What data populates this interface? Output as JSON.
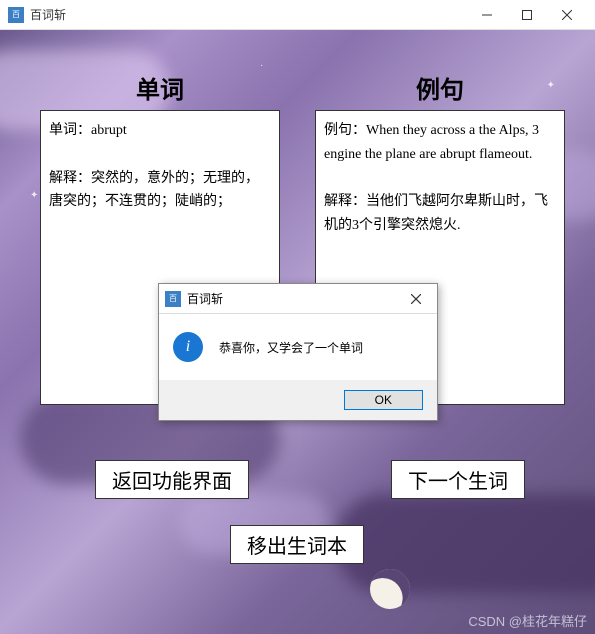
{
  "titlebar": {
    "title": "百词斩"
  },
  "headings": {
    "word": "单词",
    "example": "例句"
  },
  "word_panel": {
    "word_label": "单词：",
    "word_value": "abrupt",
    "def_label": "解释：",
    "def_value": "突然的，意外的；无理的，唐突的；不连贯的；陡峭的；"
  },
  "example_panel": {
    "sentence_label": "例句：",
    "sentence_value": "When they across a the Alps, 3 engine the plane are abrupt flameout.",
    "def_label": "解释：",
    "def_value": "当他们飞越阿尔卑斯山时，飞机的3个引擎突然熄火."
  },
  "buttons": {
    "back": "返回功能界面",
    "next": "下一个生词",
    "remove": "移出生词本"
  },
  "dialog": {
    "title": "百词斩",
    "message": "恭喜你，又学会了一个单词",
    "ok": "OK"
  },
  "watermark": "CSDN @桂花年糕仔"
}
